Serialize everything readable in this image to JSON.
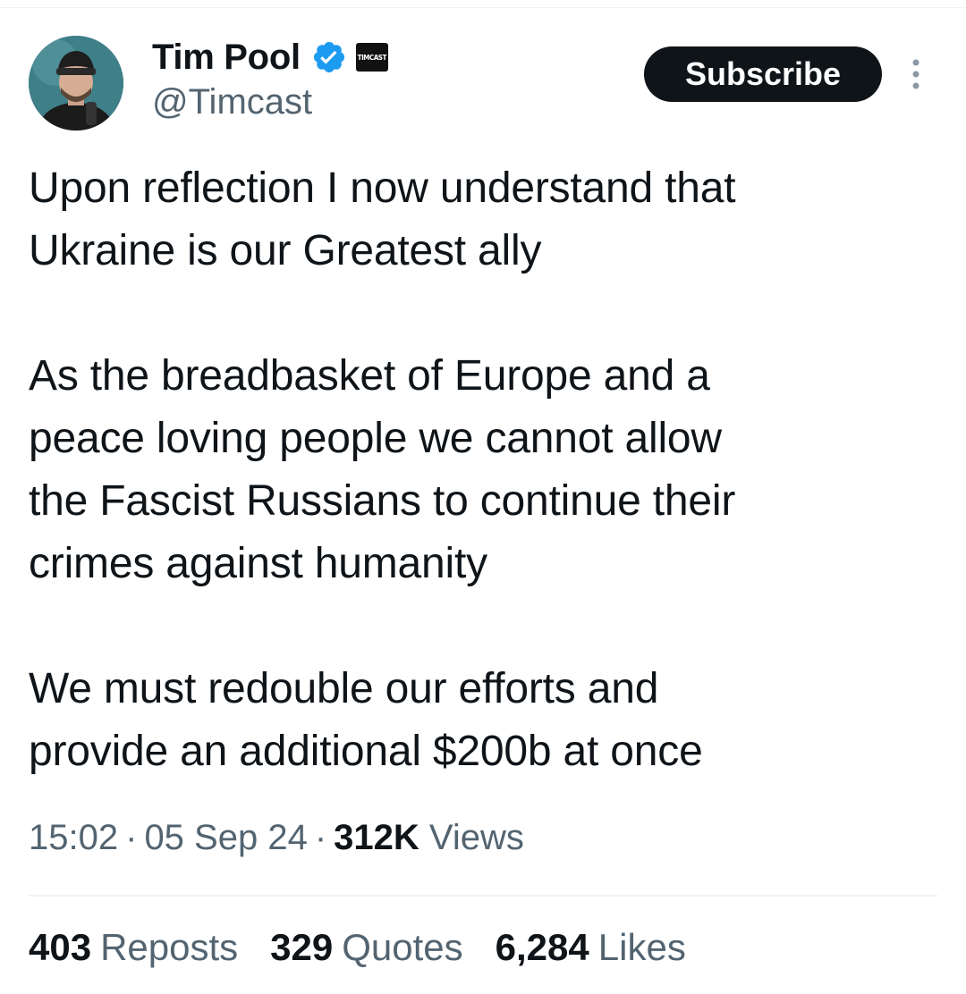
{
  "author": {
    "display_name": "Tim Pool",
    "handle": "@Timcast",
    "affiliate_badge_text": "TIMCAST",
    "verified": true,
    "avatar_icon": "profile-photo"
  },
  "subscribe_label": "Subscribe",
  "tweet": {
    "paragraphs": [
      "Upon reflection I now understand that\nUkraine is our Greatest ally",
      "As the breadbasket of Europe and a\npeace loving people we cannot allow\nthe Fascist Russians to continue their\ncrimes against humanity",
      "We must redouble our efforts and\nprovide an additional $200b at once"
    ]
  },
  "meta": {
    "time": "15:02",
    "date": "05 Sep 24",
    "separator": "·",
    "views_count": "312K",
    "views_label": "Views"
  },
  "stats": {
    "reposts_count": "403",
    "reposts_label": "Reposts",
    "quotes_count": "329",
    "quotes_label": "Quotes",
    "likes_count": "6,284",
    "likes_label": "Likes"
  },
  "colors": {
    "text_primary": "#0f1419",
    "text_secondary": "#536471",
    "verified_blue": "#1d9bf0",
    "button_bg": "#0f1419",
    "divider": "#eff3f4"
  }
}
